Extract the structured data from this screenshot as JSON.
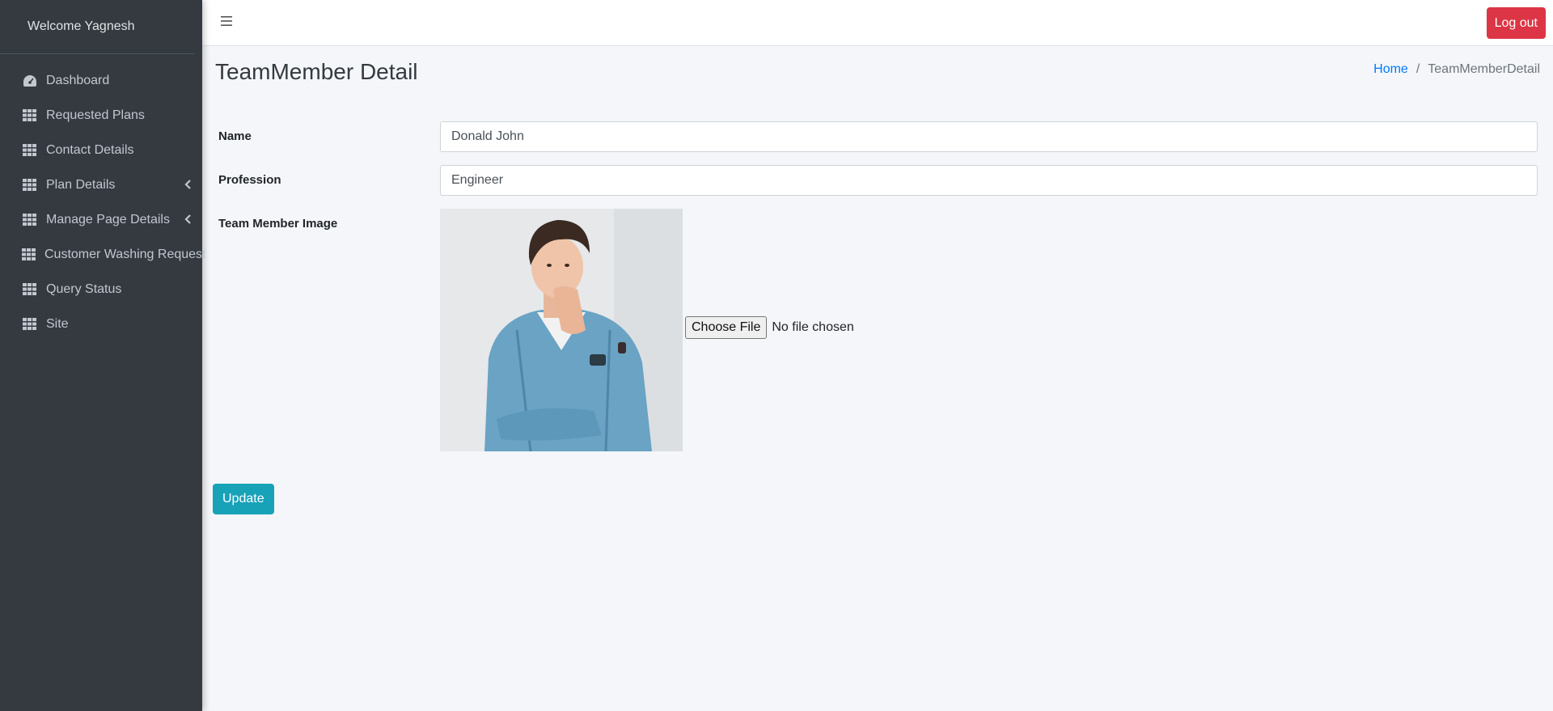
{
  "sidebar": {
    "welcome": "Welcome Yagnesh",
    "items": [
      {
        "label": "Dashboard",
        "icon": "dashboard-icon",
        "submenu": false
      },
      {
        "label": "Requested Plans",
        "icon": "grid-icon",
        "submenu": false
      },
      {
        "label": "Contact Details",
        "icon": "grid-icon",
        "submenu": false
      },
      {
        "label": "Plan Details",
        "icon": "grid-icon",
        "submenu": true
      },
      {
        "label": "Manage Page Details",
        "icon": "grid-icon",
        "submenu": true
      },
      {
        "label": "Customer Washing Request",
        "icon": "grid-icon",
        "submenu": false
      },
      {
        "label": "Query Status",
        "icon": "grid-icon",
        "submenu": false
      },
      {
        "label": "Site",
        "icon": "grid-icon",
        "submenu": false
      }
    ]
  },
  "topbar": {
    "menu_icon": "hamburger-icon",
    "logout_label": "Log out"
  },
  "page": {
    "title": "TeamMember Detail",
    "breadcrumb": {
      "home": "Home",
      "separator": "/",
      "current": "TeamMemberDetail"
    }
  },
  "form": {
    "name_label": "Name",
    "name_value": "Donald John",
    "profession_label": "Profession",
    "profession_value": "Engineer",
    "image_label": "Team Member Image",
    "file_button": "Choose File",
    "file_status": "No file chosen",
    "update_label": "Update"
  },
  "colors": {
    "sidebar_bg": "#343a40",
    "logout": "#dc3545",
    "update": "#17a2b8",
    "link": "#007bff"
  }
}
